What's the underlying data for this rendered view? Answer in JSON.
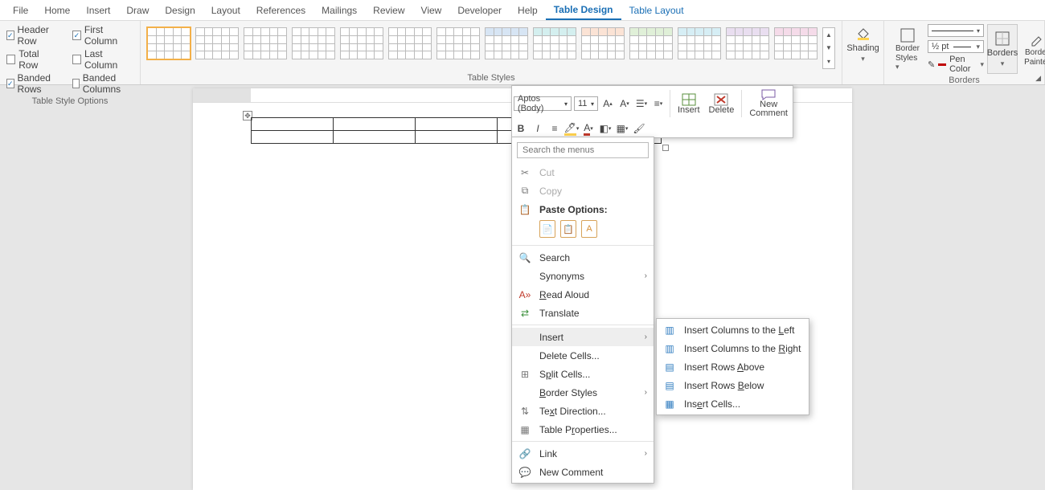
{
  "tabs": {
    "file": "File",
    "home": "Home",
    "insert": "Insert",
    "draw": "Draw",
    "design": "Design",
    "layout": "Layout",
    "references": "References",
    "mailings": "Mailings",
    "review": "Review",
    "view": "View",
    "developer": "Developer",
    "help": "Help",
    "table_design": "Table Design",
    "table_layout": "Table Layout"
  },
  "style_opts": {
    "header_row": "Header Row",
    "total_row": "Total Row",
    "banded_rows": "Banded Rows",
    "first_col": "First Column",
    "last_col": "Last Column",
    "banded_cols": "Banded Columns",
    "group": "Table Style Options"
  },
  "styles_group": "Table Styles",
  "shading": "Shading",
  "border_styles": "Border Styles",
  "pen_width": "½ pt",
  "pen_color": "Pen Color",
  "borders_btn": "Borders",
  "border_painter": "Border Painter",
  "borders_group": "Borders",
  "mini": {
    "font": "Aptos (Body)",
    "size": "11",
    "insert": "Insert",
    "delete": "Delete",
    "new_comment1": "New",
    "new_comment2": "Comment"
  },
  "ctx": {
    "search_ph": "Search the menus",
    "cut": "Cut",
    "copy": "Copy",
    "paste_options": "Paste Options:",
    "search": "Search",
    "synonyms": "Synonyms",
    "read_aloud": "Read Aloud",
    "translate": "Translate",
    "insert": "Insert",
    "delete_cells": "Delete Cells...",
    "split_cells": "Split Cells...",
    "border_styles": "Border Styles",
    "text_direction": "Text Direction...",
    "table_properties": "Table Properties...",
    "link": "Link",
    "new_comment": "New Comment"
  },
  "sub": {
    "cols_left": "Insert Columns to the Left",
    "cols_right": "Insert Columns to the Right",
    "rows_above": "Insert Rows Above",
    "rows_below": "Insert Rows Below",
    "cells": "Insert Cells..."
  }
}
